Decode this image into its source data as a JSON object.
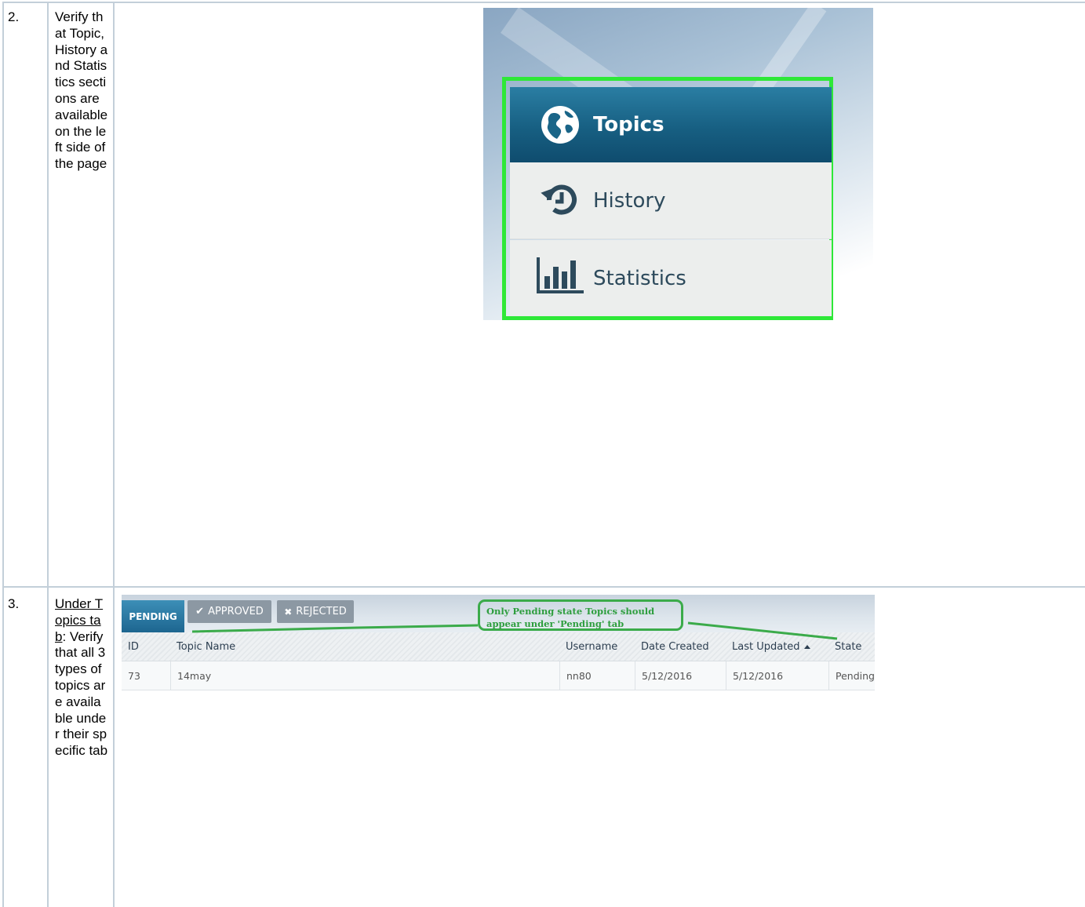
{
  "rows": [
    {
      "number": "2.",
      "description": "Verify that Topic, History and Statistics sections are available on the left side of the page",
      "nav": {
        "items": [
          {
            "label": "Topics",
            "icon": "globe-icon",
            "active": true
          },
          {
            "label": "History",
            "icon": "history-icon",
            "active": false
          },
          {
            "label": "Statistics",
            "icon": "bar-chart-icon",
            "active": false
          }
        ],
        "highlight_color": "#2ee838"
      }
    },
    {
      "number": "3.",
      "description_link": "Under Topics tab",
      "description_rest": ": Verify that all 3 types of topics are available under their specific tab",
      "tabs": {
        "pending": "PENDING",
        "approved": "APPROVED",
        "rejected": "REJECTED",
        "approved_icon": "check-icon",
        "rejected_icon": "x-icon"
      },
      "annotation": "Only Pending state Topics should appear under 'Pending' tab",
      "annotation_color": "#3bab4a",
      "table": {
        "columns": [
          "ID",
          "Topic Name",
          "Username",
          "Date Created",
          "Last Updated",
          "State"
        ],
        "sorted_column": "Last Updated",
        "sort_direction": "ascending",
        "rows": [
          [
            "73",
            "14may",
            "nn80",
            "5/12/2016",
            "5/12/2016",
            "Pending"
          ]
        ]
      }
    }
  ]
}
